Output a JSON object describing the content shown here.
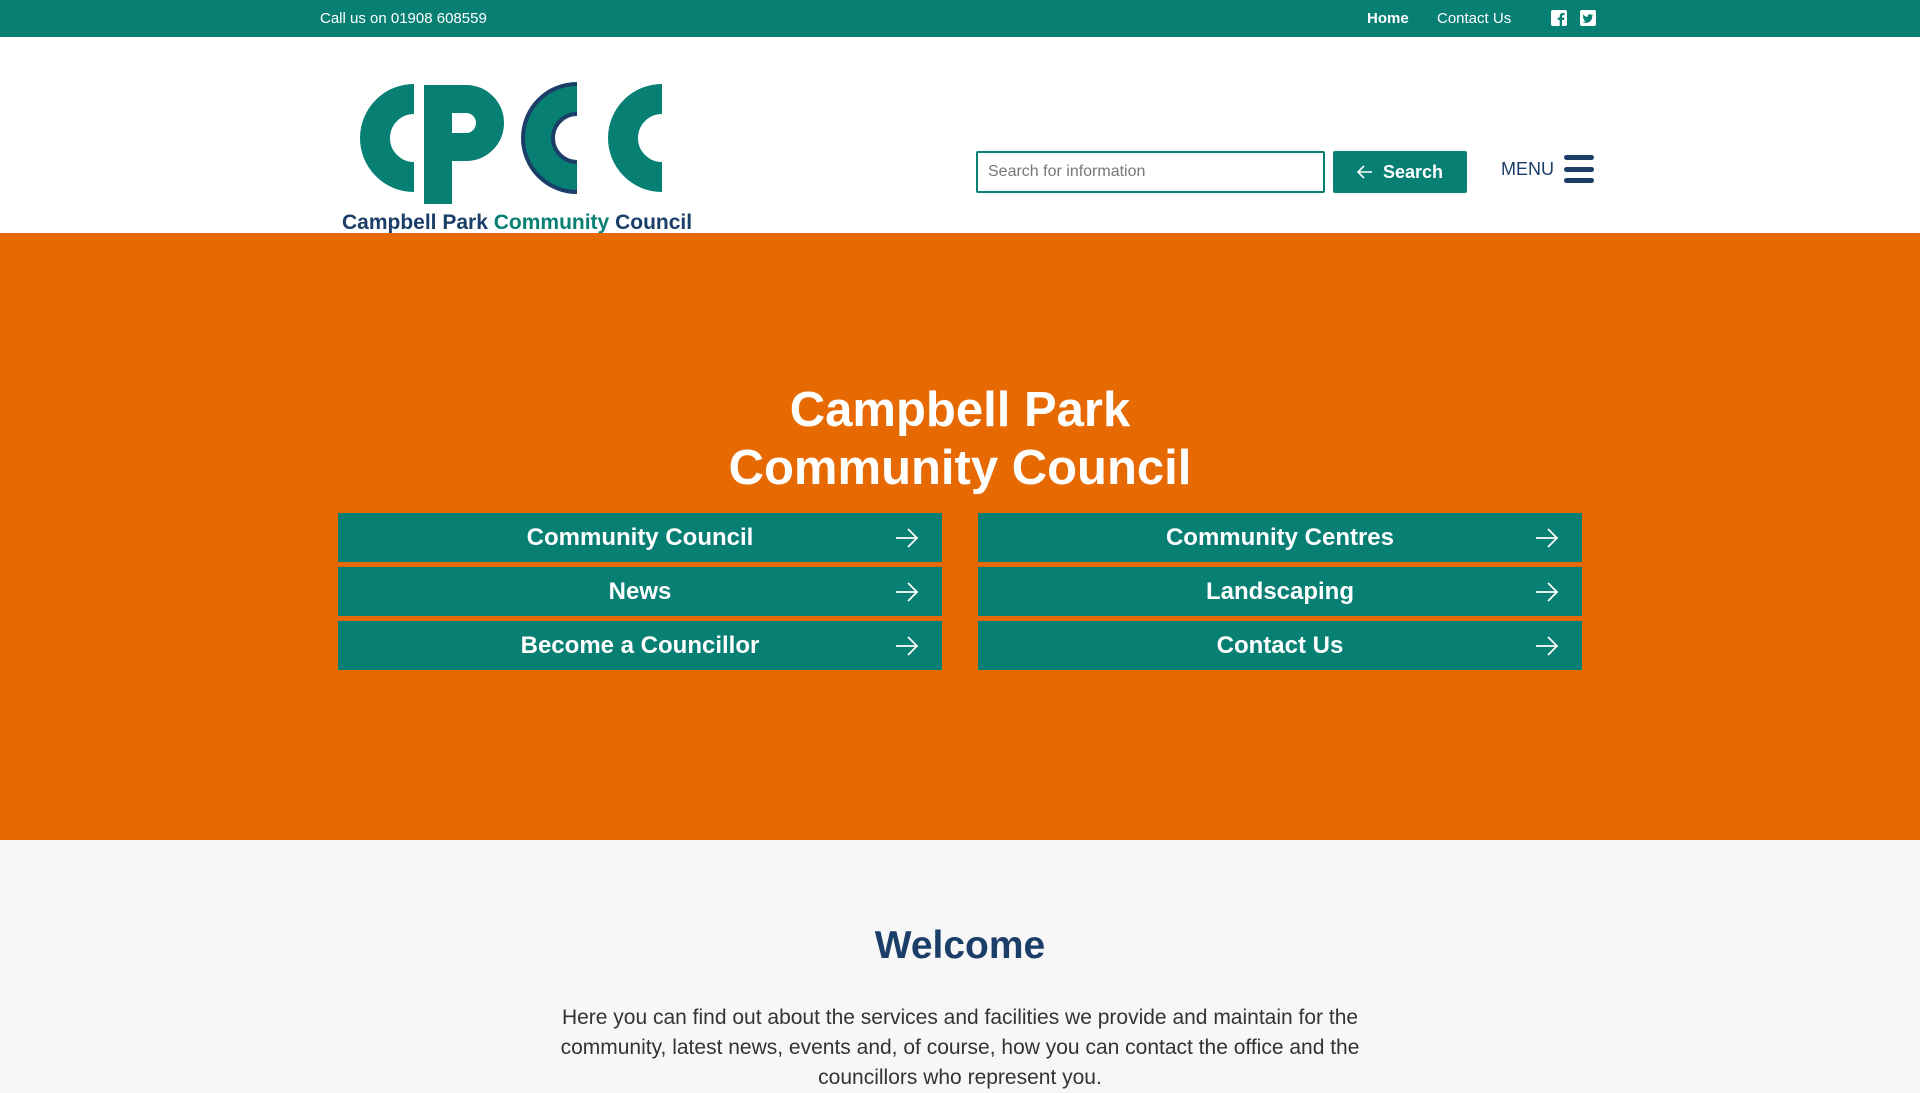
{
  "topbar": {
    "phone": "Call us on 01908 608559",
    "nav": {
      "home": "Home",
      "contact": "Contact Us"
    },
    "social_icons": [
      "facebook-icon",
      "twitter-icon"
    ]
  },
  "header": {
    "logo": {
      "letters": "CPCC",
      "caption_part1": "Campbell Park ",
      "caption_part2": "Community ",
      "caption_part3": "Council"
    },
    "search": {
      "placeholder": "Search for information",
      "value": "",
      "button_label": "Search"
    },
    "menu_label": "MENU"
  },
  "hero": {
    "title_line1": "Campbell Park",
    "title_line2": "Community Council",
    "tiles": [
      {
        "label": "Community Council"
      },
      {
        "label": "Community Centres"
      },
      {
        "label": "News"
      },
      {
        "label": "Landscaping"
      },
      {
        "label": "Become a Councillor"
      },
      {
        "label": "Contact Us"
      }
    ]
  },
  "welcome": {
    "heading": "Welcome",
    "text": "Here you can find out about the services and facilities we provide and maintain for the community, latest news, events and, of course, how you can contact the office and the councillors who represent you."
  },
  "colors": {
    "teal": "#087f73",
    "orange": "#e66a01",
    "navy": "#1a3e67",
    "background": "#f7f7f7"
  }
}
